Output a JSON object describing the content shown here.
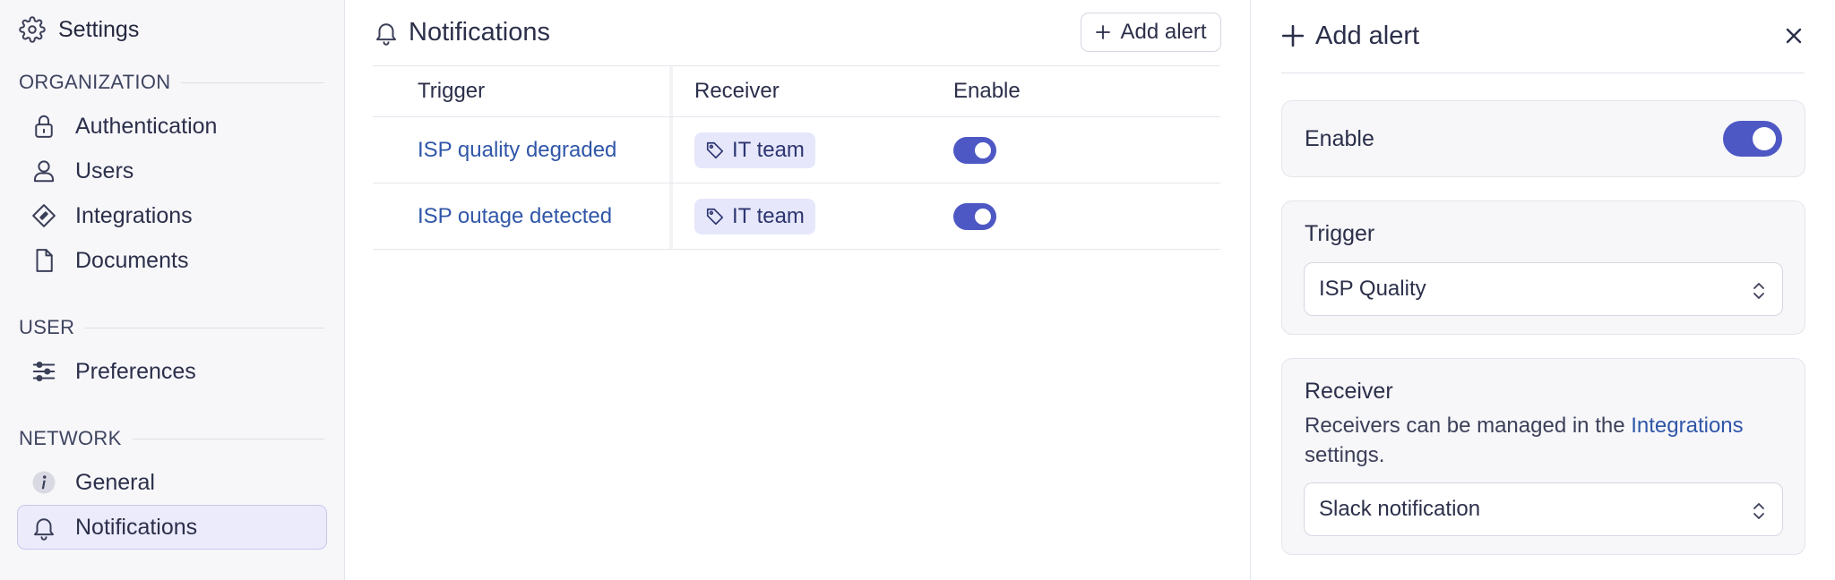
{
  "sidebar": {
    "title": "Settings",
    "sections": [
      {
        "label": "ORGANIZATION",
        "items": [
          "Authentication",
          "Users",
          "Integrations",
          "Documents"
        ]
      },
      {
        "label": "USER",
        "items": [
          "Preferences"
        ]
      },
      {
        "label": "NETWORK",
        "items": [
          "General",
          "Notifications"
        ]
      }
    ],
    "active_item": "Notifications"
  },
  "main": {
    "title": "Notifications",
    "add_button_label": "Add alert",
    "columns": [
      "Trigger",
      "Receiver",
      "Enable"
    ],
    "rows": [
      {
        "trigger": "ISP quality degraded",
        "receiver": "IT team",
        "enabled": true
      },
      {
        "trigger": "ISP outage detected",
        "receiver": "IT team",
        "enabled": true
      }
    ]
  },
  "drawer": {
    "title": "Add alert",
    "enable_label": "Enable",
    "enable_on": true,
    "trigger_label": "Trigger",
    "trigger_value": "ISP Quality",
    "receiver_label": "Receiver",
    "receiver_help_prefix": "Receivers can be managed in the",
    "receiver_help_link": "Integrations",
    "receiver_help_suffix": "settings.",
    "receiver_value": "Slack notification"
  },
  "colors": {
    "accent": "#4e58c4",
    "link": "#2f56a8",
    "tag_bg": "#e6e7fb",
    "active_item_bg": "#ebebfb"
  },
  "icons": {
    "header": "gear-icon",
    "sidebar": [
      "lock-icon",
      "user-icon",
      "tag-diamond-icon",
      "document-icon",
      "sliders-icon",
      "info-icon",
      "bell-icon"
    ],
    "close": "close-icon",
    "add": "plus-icon",
    "select": "chevron-up-down-icon"
  }
}
